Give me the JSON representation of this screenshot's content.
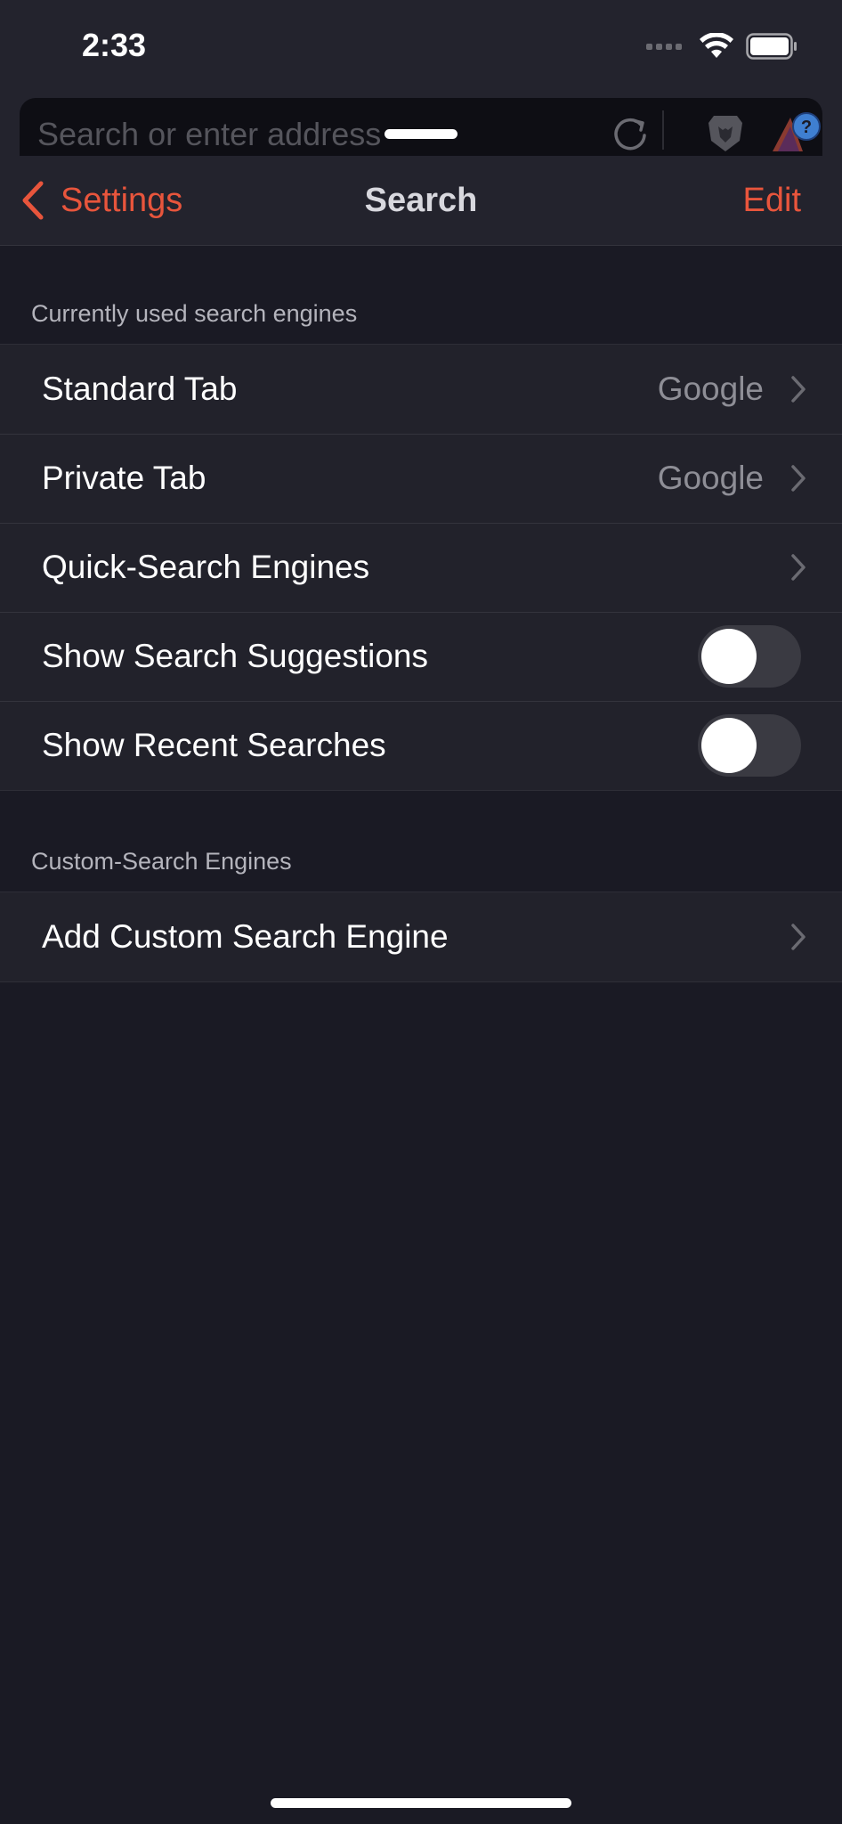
{
  "status_bar": {
    "time": "2:33",
    "icons": [
      "cellular-signal-icon",
      "wifi-icon",
      "battery-icon"
    ]
  },
  "address_bar": {
    "placeholder": "Search or enter address",
    "icons": [
      "reload-icon",
      "brave-shields-lion-icon",
      "brave-rewards-icon"
    ]
  },
  "nav": {
    "back_label": "Settings",
    "title": "Search",
    "edit_label": "Edit"
  },
  "sections": [
    {
      "header": "Currently used search engines",
      "rows": [
        {
          "label": "Standard Tab",
          "value": "Google",
          "accessory": "chevron"
        },
        {
          "label": "Private Tab",
          "value": "Google",
          "accessory": "chevron"
        },
        {
          "label": "Quick-Search Engines",
          "value": "",
          "accessory": "chevron"
        },
        {
          "label": "Show Search Suggestions",
          "toggle": false,
          "accessory": "toggle"
        },
        {
          "label": "Show Recent Searches",
          "toggle": false,
          "accessory": "toggle"
        }
      ]
    },
    {
      "header": "Custom-Search Engines",
      "rows": [
        {
          "label": "Add Custom Search Engine",
          "value": "",
          "accessory": "chevron"
        }
      ]
    }
  ],
  "colors": {
    "accent": "#e8553c",
    "background": "#1a1a24",
    "cell_background": "#22222b",
    "secondary_text": "#8e8e96"
  }
}
